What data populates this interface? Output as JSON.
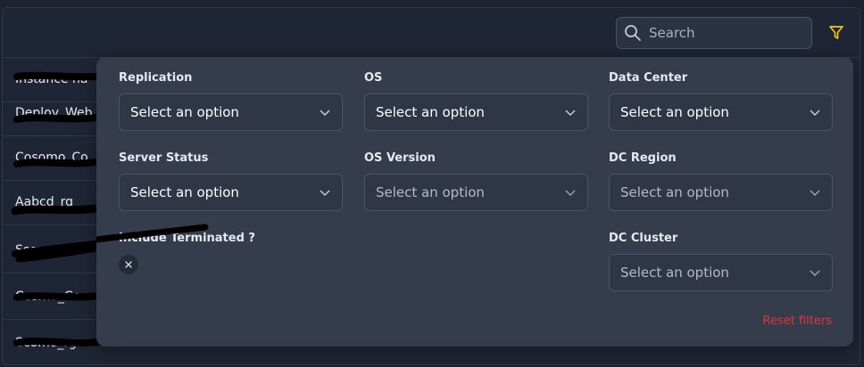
{
  "toolbar": {
    "search_placeholder": "Search",
    "search_icon": "search-icon",
    "filter_icon": "filter-icon",
    "filter_color": "#f5c518"
  },
  "table": {
    "rows": [
      {
        "label": "Instance na"
      },
      {
        "label": "Deploy_Web"
      },
      {
        "label": "Cosomo_Co"
      },
      {
        "label": "Aabcd_rg"
      },
      {
        "label": "Sscp_"
      },
      {
        "label": "Cosmo_Co"
      },
      {
        "label": "Scomo_rg"
      }
    ]
  },
  "filters": {
    "replication": {
      "label": "Replication",
      "value": "Select an option"
    },
    "os": {
      "label": "OS",
      "value": "Select an option"
    },
    "data_center": {
      "label": "Data Center",
      "value": "Select an option"
    },
    "server_status": {
      "label": "Server Status",
      "value": "Select an option"
    },
    "os_version": {
      "label": "OS Version",
      "value": "Select an option"
    },
    "dc_region": {
      "label": "DC Region",
      "value": "Select an option"
    },
    "include_terminated": {
      "label": "Include Terminated ?",
      "state": "off"
    },
    "dc_cluster": {
      "label": "DC Cluster",
      "value": "Select an option"
    },
    "reset_label": "Reset filters",
    "reset_color": "#e0343f"
  }
}
